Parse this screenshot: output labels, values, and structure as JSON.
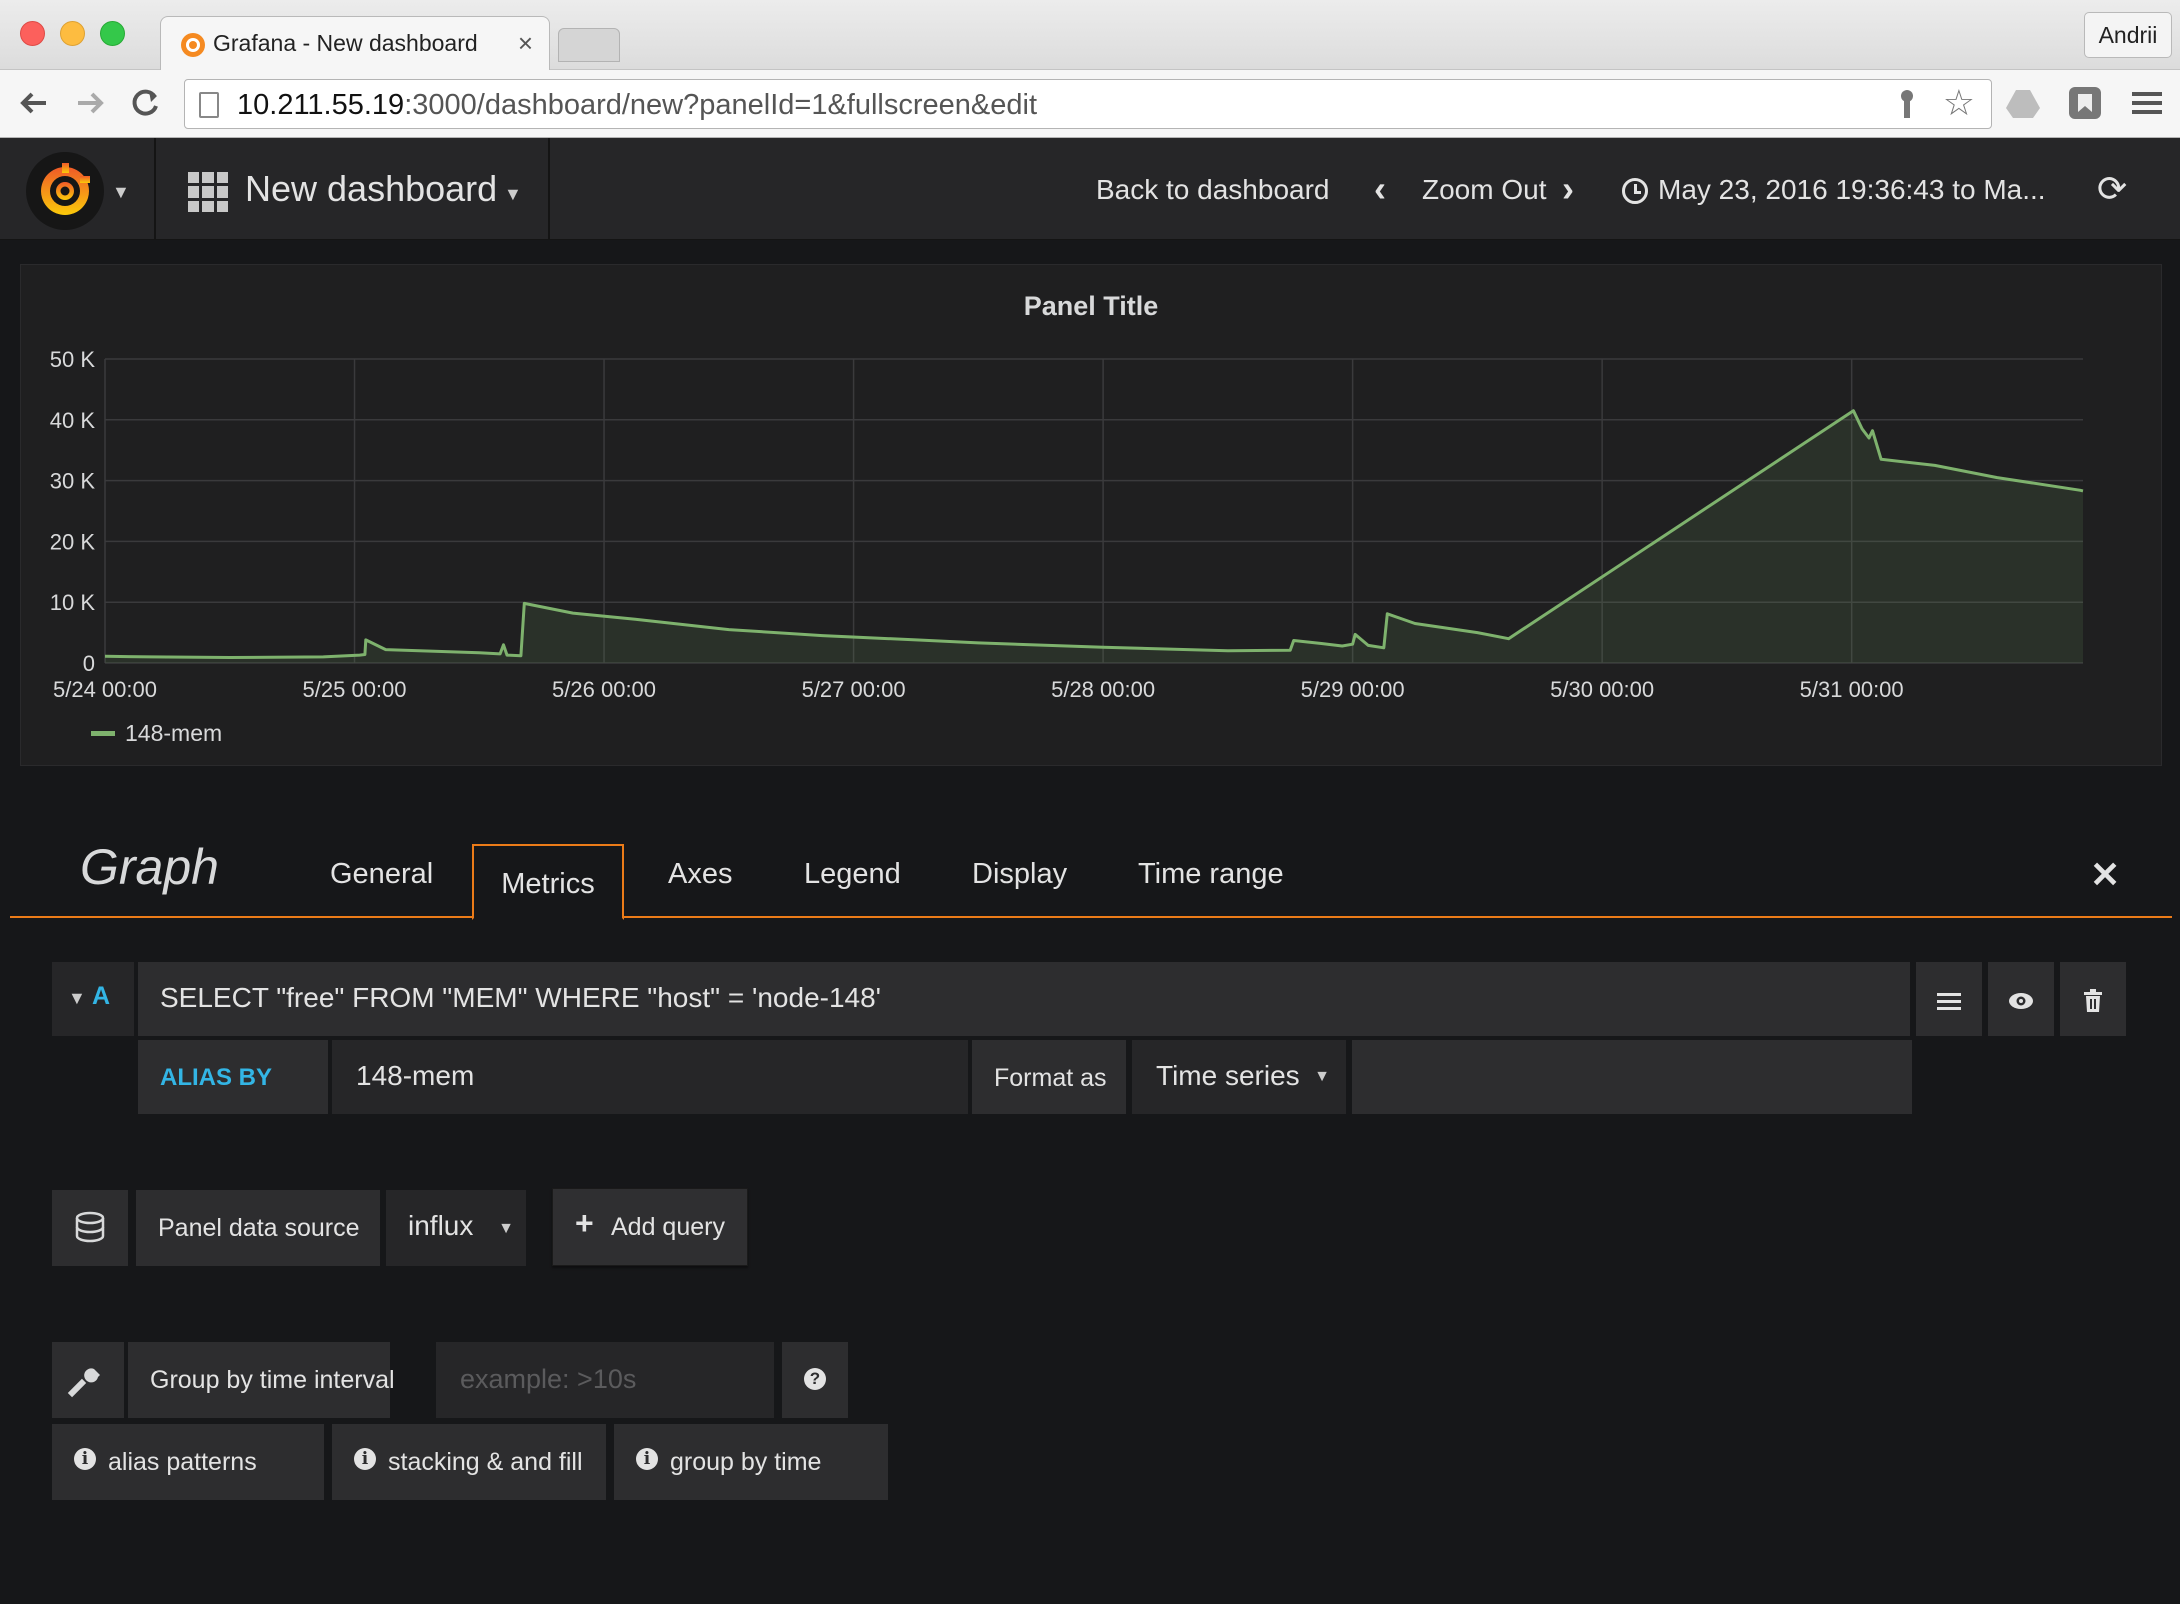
{
  "browser": {
    "tab_title": "Grafana - New dashboard",
    "tab_close": "×",
    "profile_name": "Andrii",
    "url_host": "10.211.55.19",
    "url_rest": ":3000/dashboard/new?panelId=1&fullscreen&edit",
    "icons": [
      "back-arrow-icon",
      "forward-arrow-icon",
      "reload-icon",
      "page-icon",
      "key-icon",
      "star-icon",
      "drive-icon",
      "extension-icon",
      "menu-icon"
    ]
  },
  "navbar": {
    "dashboard_title": "New dashboard",
    "back_to_dashboard": "Back to dashboard",
    "zoom_out": "Zoom Out",
    "time_range": "May 23, 2016 19:36:43 to Ma...",
    "accent": "#eb7b18"
  },
  "panel": {
    "title": "Panel Title",
    "legend": "148-mem"
  },
  "chart_data": {
    "type": "area",
    "title": "Panel Title",
    "y_tick_labels": [
      "0",
      "10 K",
      "20 K",
      "30 K",
      "40 K",
      "50 K"
    ],
    "y_ticks": [
      0,
      10000,
      20000,
      30000,
      40000,
      50000
    ],
    "ylim": [
      0,
      50000
    ],
    "x_tick_labels": [
      "5/24 00:00",
      "5/25 00:00",
      "5/26 00:00",
      "5/27 00:00",
      "5/28 00:00",
      "5/29 00:00",
      "5/30 00:00",
      "5/31 00:00"
    ],
    "x_ticks": [
      "2016-05-24T00:00",
      "2016-05-25T00:00",
      "2016-05-26T00:00",
      "2016-05-27T00:00",
      "2016-05-28T00:00",
      "2016-05-29T00:00",
      "2016-05-30T00:00",
      "2016-05-31T00:00"
    ],
    "xlim": [
      "2016-05-24T00:00",
      "2016-05-31T22:15"
    ],
    "grid": true,
    "legend_position": "bottom-left",
    "series": [
      {
        "name": "148-mem",
        "color": "#7eb26d",
        "points": [
          [
            "2016-05-24T00:00",
            1100
          ],
          [
            "2016-05-24T04:30",
            1000
          ],
          [
            "2016-05-24T12:00",
            900
          ],
          [
            "2016-05-24T21:00",
            1000
          ],
          [
            "2016-05-25T00:30",
            1300
          ],
          [
            "2016-05-25T01:00",
            1400
          ],
          [
            "2016-05-25T01:05",
            3800
          ],
          [
            "2016-05-25T03:00",
            2200
          ],
          [
            "2016-05-25T12:00",
            1700
          ],
          [
            "2016-05-25T14:00",
            1500
          ],
          [
            "2016-05-25T14:20",
            3000
          ],
          [
            "2016-05-25T14:40",
            1300
          ],
          [
            "2016-05-25T16:00",
            1200
          ],
          [
            "2016-05-25T16:20",
            9800
          ],
          [
            "2016-05-25T21:00",
            8200
          ],
          [
            "2016-05-26T03:00",
            7200
          ],
          [
            "2016-05-26T12:00",
            5500
          ],
          [
            "2016-05-26T21:00",
            4500
          ],
          [
            "2016-05-27T06:00",
            3800
          ],
          [
            "2016-05-27T12:00",
            3300
          ],
          [
            "2016-05-28T00:00",
            2600
          ],
          [
            "2016-05-28T12:00",
            2000
          ],
          [
            "2016-05-28T18:00",
            2100
          ],
          [
            "2016-05-28T18:20",
            3700
          ],
          [
            "2016-05-28T21:00",
            3200
          ],
          [
            "2016-05-28T23:00",
            2800
          ],
          [
            "2016-05-29T00:00",
            3100
          ],
          [
            "2016-05-29T00:15",
            4700
          ],
          [
            "2016-05-29T01:30",
            2900
          ],
          [
            "2016-05-29T03:00",
            2500
          ],
          [
            "2016-05-29T03:20",
            8100
          ],
          [
            "2016-05-29T06:00",
            6500
          ],
          [
            "2016-05-29T12:00",
            5000
          ],
          [
            "2016-05-29T15:00",
            4000
          ],
          [
            "2016-05-31T00:10",
            41500
          ],
          [
            "2016-05-31T01:00",
            38500
          ],
          [
            "2016-05-31T01:40",
            37000
          ],
          [
            "2016-05-31T02:00",
            38200
          ],
          [
            "2016-05-31T02:50",
            33500
          ],
          [
            "2016-05-31T08:00",
            32500
          ],
          [
            "2016-05-31T14:00",
            30500
          ],
          [
            "2016-05-31T22:00",
            28400
          ],
          [
            "2016-05-31T22:15",
            28300
          ]
        ]
      }
    ]
  },
  "editor": {
    "title": "Graph",
    "tabs": [
      "General",
      "Metrics",
      "Axes",
      "Legend",
      "Display",
      "Time range"
    ],
    "active_tab": "Metrics",
    "query": {
      "ref_id": "A",
      "text": "SELECT \"free\" FROM \"MEM\" WHERE \"host\" = 'node-148'",
      "alias_label": "ALIAS BY",
      "alias_value": "148-mem",
      "format_label": "Format as",
      "format_value": "Time series"
    },
    "datasource_label": "Panel data source",
    "datasource_value": "influx",
    "add_query": "Add query",
    "group_by_label": "Group by time interval",
    "group_by_placeholder": "example: >10s",
    "help_links": [
      "alias patterns",
      "stacking & and fill",
      "group by time"
    ]
  }
}
